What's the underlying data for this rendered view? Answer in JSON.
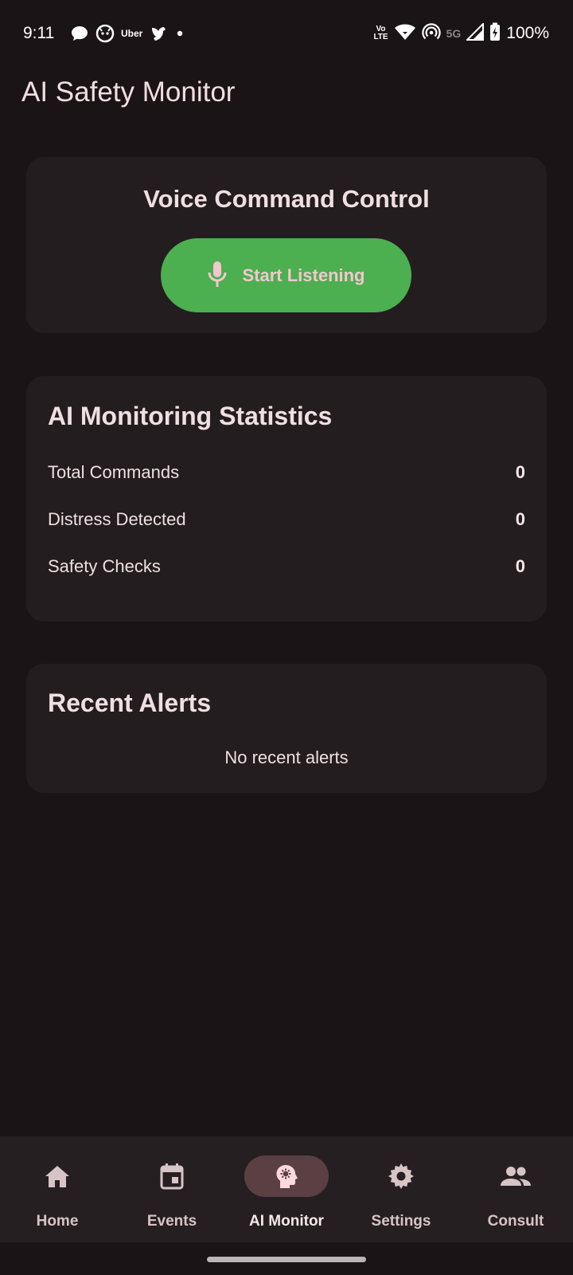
{
  "status_bar": {
    "time": "9:11",
    "uber_label": "Uber",
    "volte_top": "Vo",
    "volte_bottom": "LTE",
    "network": "5G",
    "battery": "100%"
  },
  "app": {
    "title": "AI Safety Monitor"
  },
  "voice_card": {
    "title": "Voice Command Control",
    "button_label": "Start Listening",
    "button_icon": "mic-icon",
    "button_color": "#4caf50"
  },
  "stats_card": {
    "title": "AI Monitoring Statistics",
    "rows": [
      {
        "label": "Total Commands",
        "value": "0"
      },
      {
        "label": "Distress Detected",
        "value": "0"
      },
      {
        "label": "Safety Checks",
        "value": "0"
      }
    ]
  },
  "alerts_card": {
    "title": "Recent Alerts",
    "empty_text": "No recent alerts"
  },
  "bottom_nav": {
    "items": [
      {
        "label": "Home",
        "icon": "home-icon"
      },
      {
        "label": "Events",
        "icon": "calendar-icon"
      },
      {
        "label": "AI Monitor",
        "icon": "psychology-icon",
        "active": true
      },
      {
        "label": "Settings",
        "icon": "gear-icon"
      },
      {
        "label": "Consult",
        "icon": "people-icon"
      }
    ]
  },
  "colors": {
    "background": "#1b1416",
    "card": "#231d1f",
    "accent_green": "#4caf50",
    "active_pill": "#5a4043"
  }
}
